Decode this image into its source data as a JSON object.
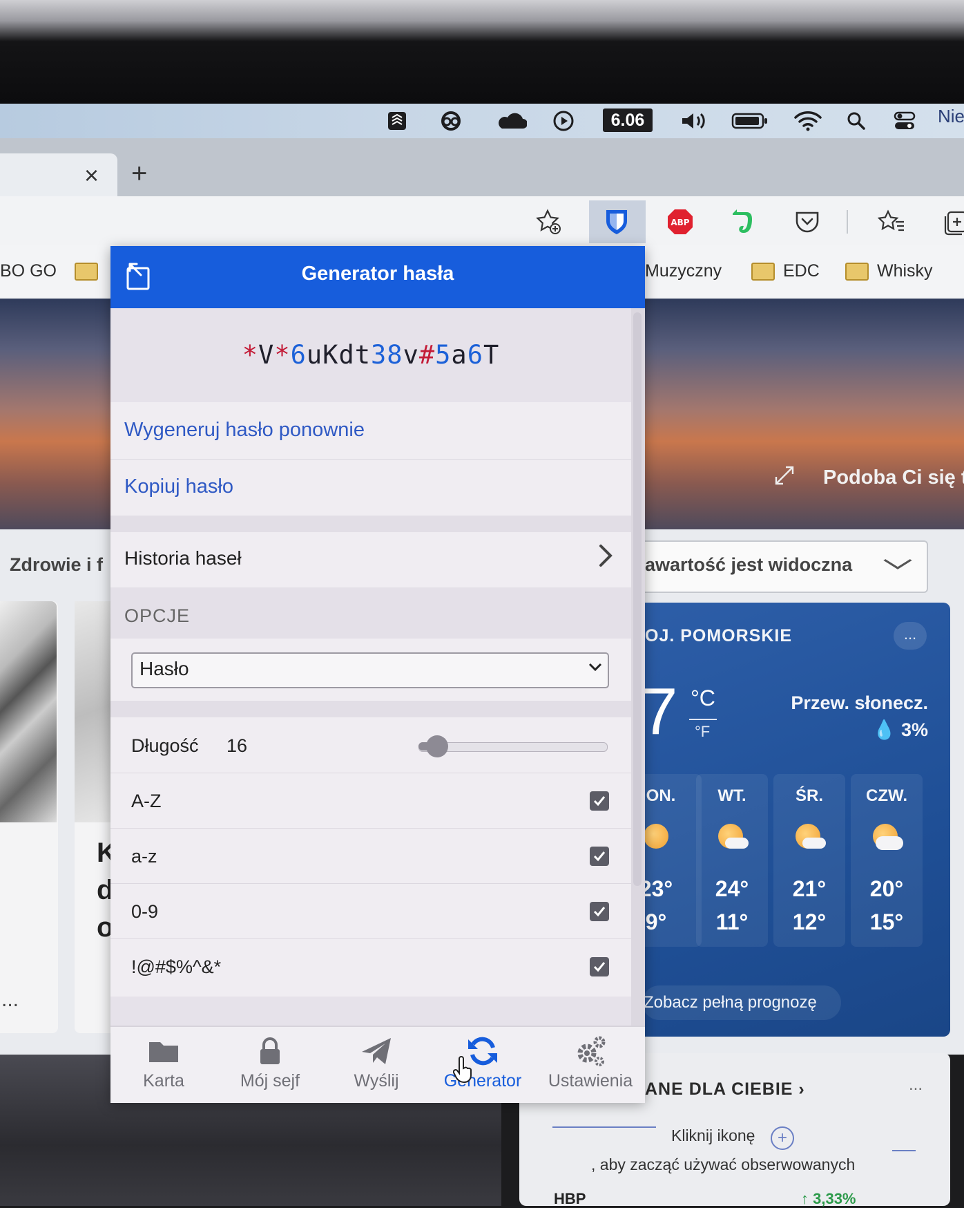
{
  "menubar": {
    "clock": "6.06",
    "more_text": "Nie",
    "icons": [
      "stack-icon",
      "creative-cloud-icon",
      "onedrive-icon",
      "play-icon",
      "volume-icon",
      "battery-icon",
      "wifi-icon",
      "search-icon",
      "control-center-icon"
    ]
  },
  "tabs": {
    "close": "×",
    "new": "+"
  },
  "bookmarks": {
    "left_partial": "BO GO",
    "items": [
      "Muzyczny",
      "EDC",
      "Whisky"
    ]
  },
  "background_page": {
    "hero_text": "Podoba Ci się t",
    "section_label": "Zdrowie i f",
    "card2_letters": [
      "K",
      "d",
      "o"
    ],
    "card1_more": "...",
    "filter_text": "awartość jest widoczna",
    "weather": {
      "location": "OJ. POMORSKIE",
      "more": "...",
      "temp": "7",
      "unit_c": "°C",
      "unit_f": "°F",
      "condition": "Przew. słonecz.",
      "precip": "💧 3%",
      "days": [
        {
          "name": "ON.",
          "high": "23°",
          "low": "9°"
        },
        {
          "name": "WT.",
          "high": "24°",
          "low": "11°"
        },
        {
          "name": "ŚR.",
          "high": "21°",
          "low": "12°"
        },
        {
          "name": "CZW.",
          "high": "20°",
          "low": "15°"
        }
      ],
      "forecast_link": "Zobacz pełną prognozę"
    },
    "section2": {
      "title": "ANE DLA CIEBIE  ›",
      "more": "...",
      "click_text": "Kliknij ikonę",
      "plus": "+",
      "desc": ", aby zacząć używać obserwowanych",
      "ticker": "HBP",
      "ticker_change": "↑ 3,33%"
    }
  },
  "popup": {
    "title": "Generator hasła",
    "password_chars": [
      {
        "c": "*",
        "t": "sym"
      },
      {
        "c": "V",
        "t": "letter"
      },
      {
        "c": "*",
        "t": "sym"
      },
      {
        "c": "6",
        "t": "num"
      },
      {
        "c": "u",
        "t": "letter"
      },
      {
        "c": "K",
        "t": "letter"
      },
      {
        "c": "d",
        "t": "letter"
      },
      {
        "c": "t",
        "t": "letter"
      },
      {
        "c": "3",
        "t": "num"
      },
      {
        "c": "8",
        "t": "num"
      },
      {
        "c": "v",
        "t": "letter"
      },
      {
        "c": "#",
        "t": "sym"
      },
      {
        "c": "5",
        "t": "num"
      },
      {
        "c": "a",
        "t": "letter"
      },
      {
        "c": "6",
        "t": "num"
      },
      {
        "c": "T",
        "t": "letter"
      }
    ],
    "regenerate": "Wygeneruj hasło ponownie",
    "copy": "Kopiuj hasło",
    "history": "Historia haseł",
    "options_header": "OPCJE",
    "type_value": "Hasło",
    "length_label": "Długość",
    "length_value": "16",
    "length_fraction": 0.1,
    "options": [
      {
        "label": "A-Z",
        "checked": true
      },
      {
        "label": "a-z",
        "checked": true
      },
      {
        "label": "0-9",
        "checked": true
      },
      {
        "label": "!@#$%^&*",
        "checked": true
      }
    ],
    "nav": [
      {
        "label": "Karta",
        "icon": "folder-icon"
      },
      {
        "label": "Mój sejf",
        "icon": "lock-icon"
      },
      {
        "label": "Wyślij",
        "icon": "send-icon"
      },
      {
        "label": "Generator",
        "icon": "refresh-icon"
      },
      {
        "label": "Ustawienia",
        "icon": "gears-icon"
      }
    ]
  },
  "colors": {
    "accent": "#175ddc",
    "password_number": "#1c61d8",
    "password_symbol": "#c31c38"
  }
}
